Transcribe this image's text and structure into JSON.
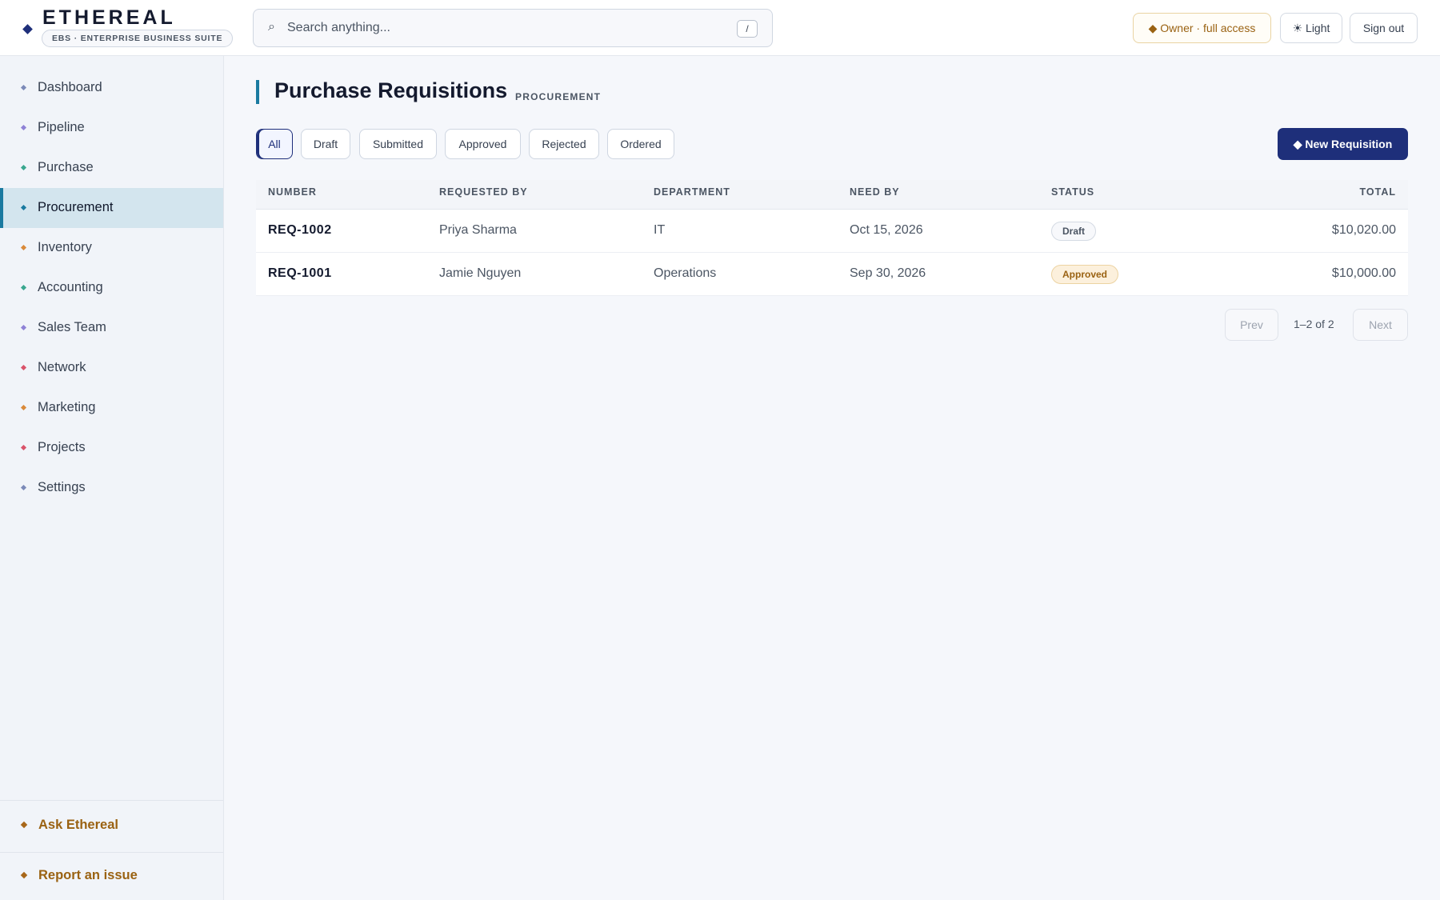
{
  "header": {
    "brand_name": "ETHEREAL",
    "brand_tagline": "EBS · ENTERPRISE BUSINESS SUITE",
    "search": {
      "placeholder": "Search anything...",
      "value": "",
      "shortcut": "/"
    },
    "role_badge": "◆ Owner · full access",
    "theme_button": "☀ Light",
    "signout_button": "Sign out"
  },
  "sidebar": {
    "items": [
      {
        "label": "Dashboard",
        "color": "#7b8ab8"
      },
      {
        "label": "Pipeline",
        "color": "#8f82d6"
      },
      {
        "label": "Purchase",
        "color": "#3aa78f"
      },
      {
        "label": "Procurement",
        "color": "#1a7aa0",
        "active": true
      },
      {
        "label": "Inventory",
        "color": "#d98a3a"
      },
      {
        "label": "Accounting",
        "color": "#3aa78f"
      },
      {
        "label": "Sales Team",
        "color": "#8f82d6"
      },
      {
        "label": "Network",
        "color": "#d9536a"
      },
      {
        "label": "Marketing",
        "color": "#d98a3a"
      },
      {
        "label": "Projects",
        "color": "#d9536a"
      },
      {
        "label": "Settings",
        "color": "#7b8ab8"
      }
    ],
    "ask_label": "Ask Ethereal",
    "report_label": "Report an issue"
  },
  "main": {
    "title": "Purchase Requisitions",
    "subtitle": "PROCUREMENT",
    "filters": [
      "All",
      "Draft",
      "Submitted",
      "Approved",
      "Rejected",
      "Ordered"
    ],
    "active_filter": "All",
    "new_button": "◆ New Requisition",
    "table": {
      "columns": [
        "NUMBER",
        "REQUESTED BY",
        "DEPARTMENT",
        "NEED BY",
        "STATUS",
        "TOTAL"
      ],
      "rows": [
        {
          "number": "REQ-1002",
          "requested_by": "Priya Sharma",
          "department": "IT",
          "need_by": "Oct 15, 2026",
          "status": "Draft",
          "total": "$10,020.00"
        },
        {
          "number": "REQ-1001",
          "requested_by": "Jamie Nguyen",
          "department": "Operations",
          "need_by": "Sep 30, 2026",
          "status": "Approved",
          "total": "$10,000.00"
        }
      ]
    },
    "pagination": {
      "prev": "Prev",
      "range": "1–2 of 2",
      "next": "Next"
    }
  },
  "colors": {
    "brand": "#1e2f7a",
    "accent": "#1a7aa0",
    "gold": "#9a6212"
  }
}
